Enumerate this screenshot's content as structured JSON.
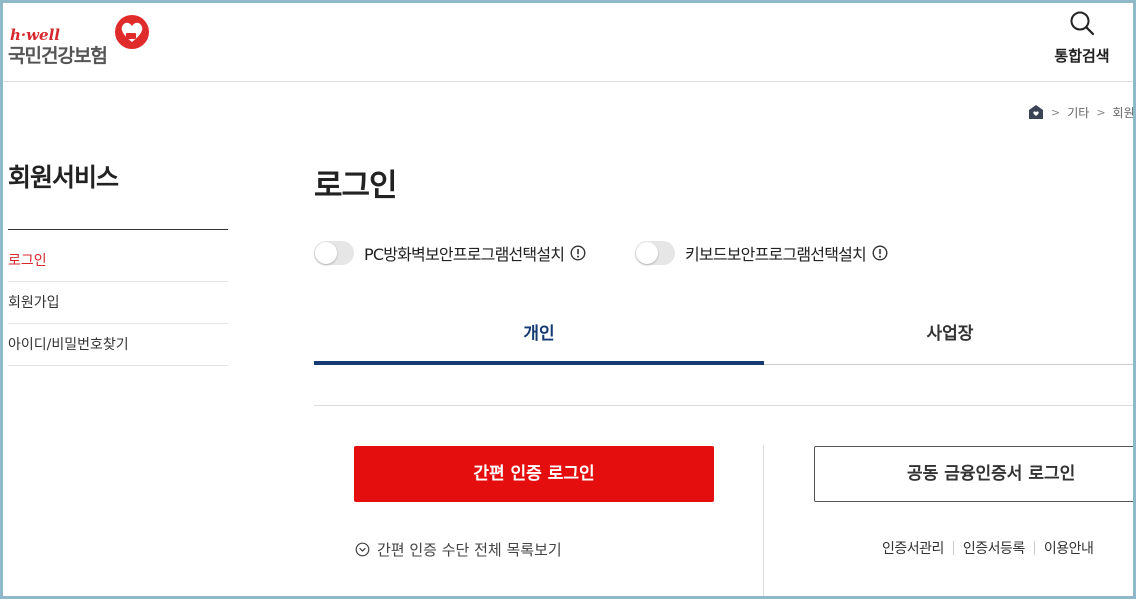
{
  "header": {
    "logo_tagline": "h·well",
    "logo_name": "국민건강보험",
    "search_label": "통합검색"
  },
  "breadcrumb": {
    "items": [
      "기타",
      "회원"
    ]
  },
  "sidebar": {
    "title": "회원서비스",
    "items": [
      {
        "label": "로그인",
        "active": true
      },
      {
        "label": "회원가입",
        "active": false
      },
      {
        "label": "아이디/비밀번호찾기",
        "active": false
      }
    ]
  },
  "main": {
    "title": "로그인",
    "toggles": [
      {
        "label": "PC방화벽보안프로그램선택설치",
        "on": false
      },
      {
        "label": "키보드보안프로그램선택설치",
        "on": false
      }
    ],
    "tabs": [
      {
        "label": "개인",
        "selected": true
      },
      {
        "label": "사업장",
        "selected": false
      }
    ],
    "simple_login_button": "간편 인증 로그인",
    "cert_login_button": "공동 금융인증서 로그인",
    "more_methods_link": "간편 인증 수단 전체 목록보기",
    "cert_links": [
      "인증서관리",
      "인증서등록",
      "이용안내"
    ]
  },
  "colors": {
    "brand_red": "#e50e0e",
    "active_menu": "#d7282f",
    "tab_active": "#163a72"
  },
  "icons": [
    "heart-logo-icon",
    "search-icon",
    "home-icon",
    "info-icon",
    "chevron-down-circle-icon"
  ]
}
